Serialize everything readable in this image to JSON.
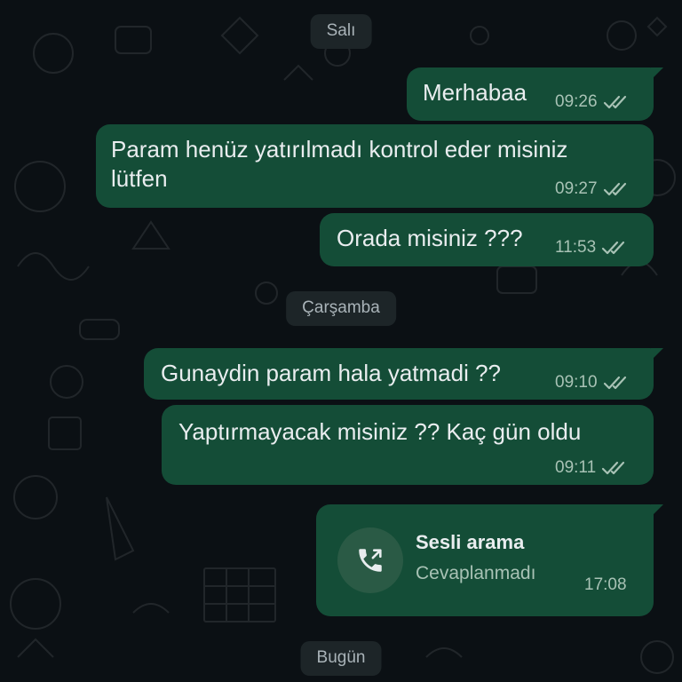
{
  "days": {
    "tuesday": "Salı",
    "wednesday": "Çarşamba",
    "today": "Bugün"
  },
  "messages": [
    {
      "text": "Merhabaa",
      "time": "09:26",
      "status": "read-ticks-icon"
    },
    {
      "text": "Param henüz yatırılmadı kontrol eder misiniz\nlütfen",
      "time": "09:27",
      "status": "read-ticks-icon"
    },
    {
      "text": "Orada misiniz ???",
      "time": "11:53",
      "status": "read-ticks-icon"
    },
    {
      "text": "Gunaydin param hala yatmadi ??",
      "time": "09:10",
      "status": "read-ticks-icon"
    },
    {
      "text": "Yaptırmayacak misiniz ?? Kaç gün oldu",
      "time": "09:11",
      "status": "read-ticks-icon"
    }
  ],
  "call": {
    "icon": "missed-outgoing-call-icon",
    "title": "Sesli arama",
    "subtitle": "Cevaplanmadı",
    "time": "17:08"
  },
  "colors": {
    "background": "#0b1014",
    "outgoing_bubble": "#144d37",
    "date_chip": "#1d2528",
    "text": "#e9edef",
    "meta": "#a8c2b5"
  }
}
